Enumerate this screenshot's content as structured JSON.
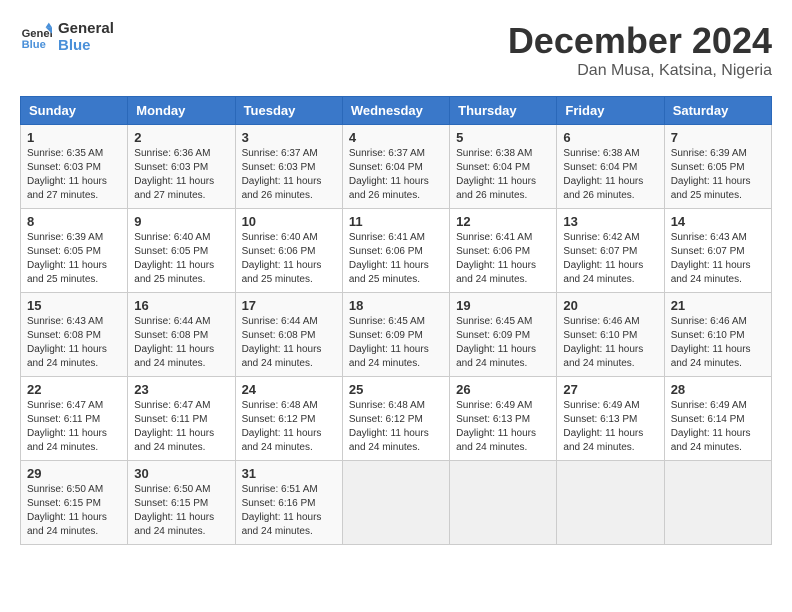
{
  "logo": {
    "line1": "General",
    "line2": "Blue"
  },
  "title": "December 2024",
  "subtitle": "Dan Musa, Katsina, Nigeria",
  "headers": [
    "Sunday",
    "Monday",
    "Tuesday",
    "Wednesday",
    "Thursday",
    "Friday",
    "Saturday"
  ],
  "weeks": [
    [
      {
        "day": "1",
        "info": "Sunrise: 6:35 AM\nSunset: 6:03 PM\nDaylight: 11 hours\nand 27 minutes."
      },
      {
        "day": "2",
        "info": "Sunrise: 6:36 AM\nSunset: 6:03 PM\nDaylight: 11 hours\nand 27 minutes."
      },
      {
        "day": "3",
        "info": "Sunrise: 6:37 AM\nSunset: 6:03 PM\nDaylight: 11 hours\nand 26 minutes."
      },
      {
        "day": "4",
        "info": "Sunrise: 6:37 AM\nSunset: 6:04 PM\nDaylight: 11 hours\nand 26 minutes."
      },
      {
        "day": "5",
        "info": "Sunrise: 6:38 AM\nSunset: 6:04 PM\nDaylight: 11 hours\nand 26 minutes."
      },
      {
        "day": "6",
        "info": "Sunrise: 6:38 AM\nSunset: 6:04 PM\nDaylight: 11 hours\nand 26 minutes."
      },
      {
        "day": "7",
        "info": "Sunrise: 6:39 AM\nSunset: 6:05 PM\nDaylight: 11 hours\nand 25 minutes."
      }
    ],
    [
      {
        "day": "8",
        "info": "Sunrise: 6:39 AM\nSunset: 6:05 PM\nDaylight: 11 hours\nand 25 minutes."
      },
      {
        "day": "9",
        "info": "Sunrise: 6:40 AM\nSunset: 6:05 PM\nDaylight: 11 hours\nand 25 minutes."
      },
      {
        "day": "10",
        "info": "Sunrise: 6:40 AM\nSunset: 6:06 PM\nDaylight: 11 hours\nand 25 minutes."
      },
      {
        "day": "11",
        "info": "Sunrise: 6:41 AM\nSunset: 6:06 PM\nDaylight: 11 hours\nand 25 minutes."
      },
      {
        "day": "12",
        "info": "Sunrise: 6:41 AM\nSunset: 6:06 PM\nDaylight: 11 hours\nand 24 minutes."
      },
      {
        "day": "13",
        "info": "Sunrise: 6:42 AM\nSunset: 6:07 PM\nDaylight: 11 hours\nand 24 minutes."
      },
      {
        "day": "14",
        "info": "Sunrise: 6:43 AM\nSunset: 6:07 PM\nDaylight: 11 hours\nand 24 minutes."
      }
    ],
    [
      {
        "day": "15",
        "info": "Sunrise: 6:43 AM\nSunset: 6:08 PM\nDaylight: 11 hours\nand 24 minutes."
      },
      {
        "day": "16",
        "info": "Sunrise: 6:44 AM\nSunset: 6:08 PM\nDaylight: 11 hours\nand 24 minutes."
      },
      {
        "day": "17",
        "info": "Sunrise: 6:44 AM\nSunset: 6:08 PM\nDaylight: 11 hours\nand 24 minutes."
      },
      {
        "day": "18",
        "info": "Sunrise: 6:45 AM\nSunset: 6:09 PM\nDaylight: 11 hours\nand 24 minutes."
      },
      {
        "day": "19",
        "info": "Sunrise: 6:45 AM\nSunset: 6:09 PM\nDaylight: 11 hours\nand 24 minutes."
      },
      {
        "day": "20",
        "info": "Sunrise: 6:46 AM\nSunset: 6:10 PM\nDaylight: 11 hours\nand 24 minutes."
      },
      {
        "day": "21",
        "info": "Sunrise: 6:46 AM\nSunset: 6:10 PM\nDaylight: 11 hours\nand 24 minutes."
      }
    ],
    [
      {
        "day": "22",
        "info": "Sunrise: 6:47 AM\nSunset: 6:11 PM\nDaylight: 11 hours\nand 24 minutes."
      },
      {
        "day": "23",
        "info": "Sunrise: 6:47 AM\nSunset: 6:11 PM\nDaylight: 11 hours\nand 24 minutes."
      },
      {
        "day": "24",
        "info": "Sunrise: 6:48 AM\nSunset: 6:12 PM\nDaylight: 11 hours\nand 24 minutes."
      },
      {
        "day": "25",
        "info": "Sunrise: 6:48 AM\nSunset: 6:12 PM\nDaylight: 11 hours\nand 24 minutes."
      },
      {
        "day": "26",
        "info": "Sunrise: 6:49 AM\nSunset: 6:13 PM\nDaylight: 11 hours\nand 24 minutes."
      },
      {
        "day": "27",
        "info": "Sunrise: 6:49 AM\nSunset: 6:13 PM\nDaylight: 11 hours\nand 24 minutes."
      },
      {
        "day": "28",
        "info": "Sunrise: 6:49 AM\nSunset: 6:14 PM\nDaylight: 11 hours\nand 24 minutes."
      }
    ],
    [
      {
        "day": "29",
        "info": "Sunrise: 6:50 AM\nSunset: 6:15 PM\nDaylight: 11 hours\nand 24 minutes."
      },
      {
        "day": "30",
        "info": "Sunrise: 6:50 AM\nSunset: 6:15 PM\nDaylight: 11 hours\nand 24 minutes."
      },
      {
        "day": "31",
        "info": "Sunrise: 6:51 AM\nSunset: 6:16 PM\nDaylight: 11 hours\nand 24 minutes."
      },
      null,
      null,
      null,
      null
    ]
  ]
}
